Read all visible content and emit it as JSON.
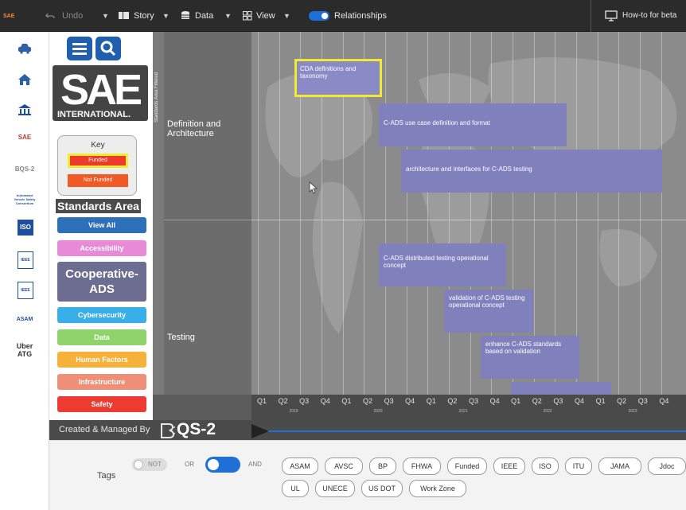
{
  "toolbar": {
    "brand": "SAE",
    "items": [
      "Undo",
      "Story",
      "Data",
      "View"
    ],
    "toggle_label": "Relationships",
    "help_label": "How-to for beta"
  },
  "libraries": [
    {
      "label": "",
      "icon": "car-icon"
    },
    {
      "label": "",
      "icon": "home-icon"
    },
    {
      "label": "",
      "icon": "institution-icon"
    },
    {
      "label": "SAE",
      "icon": "sae-logo"
    },
    {
      "label": "BQS-2",
      "icon": "bqs2-logo"
    },
    {
      "label": "Automated Vehicle Safety Consortium",
      "icon": "avsc-logo"
    },
    {
      "label": "ISO",
      "icon": "iso-logo"
    },
    {
      "label": "IEEE",
      "icon": "ieee-logo"
    },
    {
      "label": "IEEE",
      "icon": "ieee-logo-2"
    },
    {
      "label": "ASAM",
      "icon": "asam-logo"
    },
    {
      "label": "Uber ATG",
      "icon": "uber-atg-logo"
    }
  ],
  "left_panel": {
    "brand": "SAE",
    "brand_sub": "INTERNATIONAL.",
    "key_title": "Key",
    "key_funded": "Funded",
    "key_not_funded": "Not Funded",
    "standards_area_title": "Standards Area",
    "buttons": [
      {
        "label": "View All",
        "color": "#2d6fb8"
      },
      {
        "label": "Accessibility",
        "color": "#e88ad8"
      },
      {
        "label": "Cooperative-ADS",
        "color": "#6d6d92"
      },
      {
        "label": "Cybersecurity",
        "color": "#3aaee8"
      },
      {
        "label": "Data",
        "color": "#8ed46a"
      },
      {
        "label": "Human Factors",
        "color": "#f5b13a"
      },
      {
        "label": "Infrastructure",
        "color": "#ee8f78"
      },
      {
        "label": "Safety",
        "color": "#ec3b30"
      }
    ]
  },
  "chart": {
    "filter_label": "Standards Area Filtered",
    "rows": [
      "Definition and Architecture",
      "Testing"
    ],
    "quarters": [
      "Q1",
      "Q2",
      "Q3",
      "Q4",
      "Q1",
      "Q2",
      "Q3",
      "Q4",
      "Q1",
      "Q2",
      "Q3",
      "Q4",
      "Q1",
      "Q2",
      "Q3",
      "Q4",
      "Q1",
      "Q2",
      "Q3",
      "Q4"
    ],
    "years": [
      "2019",
      "2020",
      "2021",
      "2022",
      "2023"
    ],
    "tasks": [
      {
        "label": "CDA definitions and taxonomy",
        "highlighted": true
      },
      {
        "label": "C-ADS use case definition and format",
        "highlighted": false
      },
      {
        "label": "architecture and interfaces for C-ADS testing",
        "highlighted": false
      },
      {
        "label": "C-ADS distributed testing operational concept",
        "highlighted": false
      },
      {
        "label": "validation of C-ADS testing operational concept",
        "highlighted": false
      },
      {
        "label": "enhance C-ADS standards based on validation",
        "highlighted": false
      },
      {
        "label": "",
        "highlighted": false
      }
    ]
  },
  "footer": {
    "created_by": "Created & Managed By",
    "logo_text": "QS-2"
  },
  "tags": {
    "label": "Tags",
    "not_label": "NOT",
    "or_label": "OR",
    "and_label": "AND",
    "items": [
      "ASAM",
      "AVSC",
      "BP",
      "FHWA",
      "Funded",
      "IEEE",
      "ISO",
      "ITU",
      "JAMA",
      "Jdoc",
      "UL",
      "UNECE",
      "US DOT",
      "Work Zone"
    ]
  },
  "colors": {
    "accent_blue": "#1f6fd6",
    "highlight_yellow": "#f4ea2d",
    "task_fill": "#8080bd"
  }
}
